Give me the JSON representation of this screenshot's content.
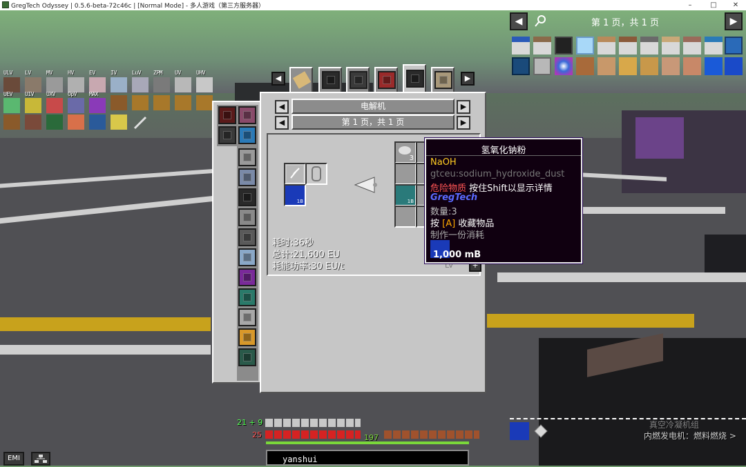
{
  "window": {
    "title": "GregTech Odyssey | 0.5.6-beta-72c46c | [Normal Mode] - 多人游戏（第三方服务器）",
    "minimize": "–",
    "maximize": "□",
    "close": "✕"
  },
  "jei": {
    "page_label": "第 1 页，共 1 页",
    "prev": "◀",
    "next": "▶",
    "search_icon": "search-icon"
  },
  "tiers": {
    "row1": [
      "ULV",
      "LV",
      "MV",
      "HV",
      "EV",
      "IV",
      "LuV",
      "ZPM",
      "UV",
      "UHV"
    ],
    "row2": [
      "UEV",
      "UIV",
      "UXV",
      "OpV",
      "MAX"
    ]
  },
  "recipe": {
    "machine_name": "电解机",
    "page_label": "第 1 页，共 1 页",
    "duration": "耗时:36秒",
    "total": "总计:21,600 EU",
    "power": "耗能功率:30 EU/t",
    "input_fluid_amount": "1B",
    "output_count": "3",
    "output_fluid_amount": "1B",
    "tier_badge": "LV"
  },
  "tooltip": {
    "title": "氢氧化钠粉",
    "formula": "NaOH",
    "registry_id": "gtceu:sodium_hydroxide_dust",
    "hazard": "危险物质",
    "hazard_hint": "按住Shift以显示详情",
    "mod": "GregTech",
    "quantity": "数量:3",
    "press": "按",
    "key": "[A]",
    "favorite": "收藏物品",
    "consume": "制作一份消耗",
    "fluid_amount": "1,000 mB"
  },
  "hud": {
    "armor_value": "21 + 9",
    "health_value": "25",
    "xp_level": "197",
    "hotbar_item_name": "yanshui",
    "hint_title": "真空冷凝机组",
    "hint_line": "内燃发电机：燃料燃烧 >",
    "emi_label": "EMI"
  },
  "colors": {
    "tooltip_title": "#ffffff",
    "formula": "#ffcc22",
    "registry": "#777777",
    "hazard": "#ff5555",
    "mod": "#5555ff",
    "key": "#ffaa00"
  }
}
